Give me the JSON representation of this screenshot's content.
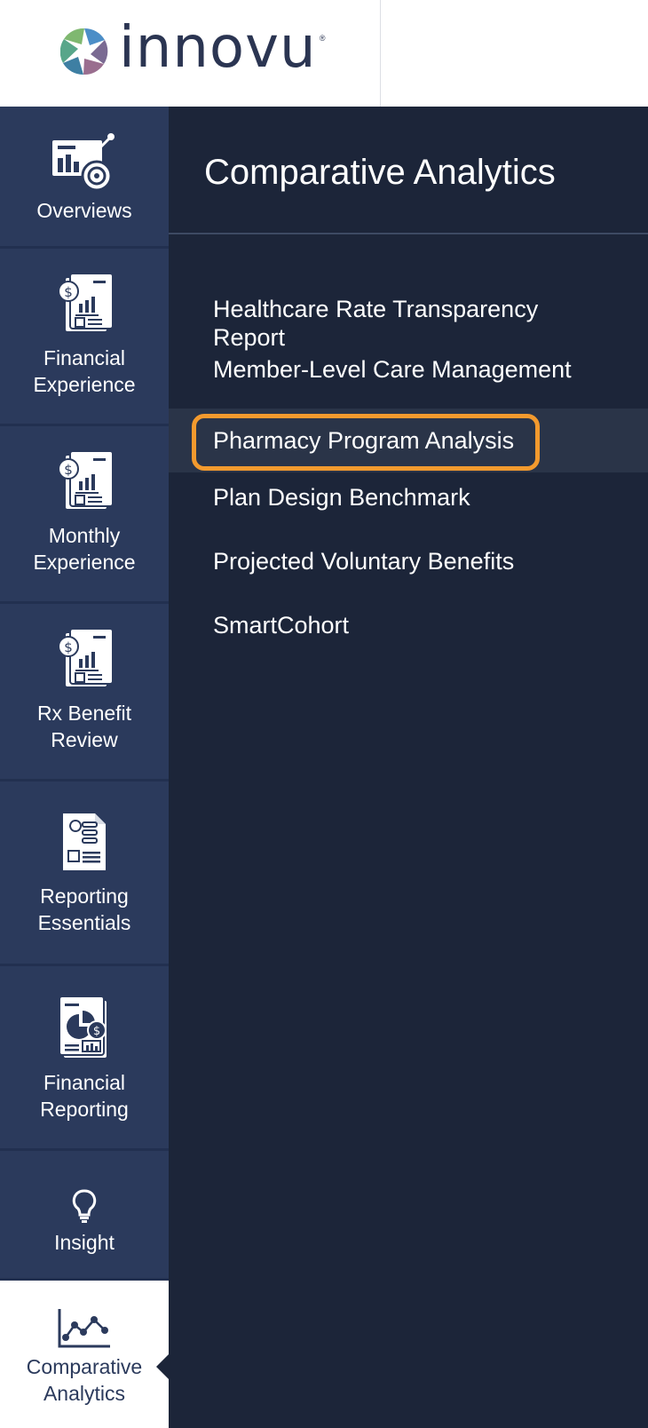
{
  "header": {
    "logo_text": "innovu",
    "logo_mark": "®"
  },
  "sidebar": {
    "items": [
      {
        "label": "Overviews",
        "icon": "analytics-dashboard-icon"
      },
      {
        "label": "Financial\nExperience",
        "icon": "financial-report-icon"
      },
      {
        "label": "Monthly\nExperience",
        "icon": "financial-report-icon"
      },
      {
        "label": "Rx Benefit\nReview",
        "icon": "financial-report-icon"
      },
      {
        "label": "Reporting\nEssentials",
        "icon": "report-document-icon"
      },
      {
        "label": "Financial\nReporting",
        "icon": "pie-chart-report-icon"
      },
      {
        "label": "Insight",
        "icon": "lightbulb-icon"
      },
      {
        "label": "Comparative\nAnalytics",
        "icon": "line-chart-icon"
      }
    ],
    "active_index": 7
  },
  "panel": {
    "title": "Comparative Analytics",
    "items": [
      "Healthcare Rate Transparency\nReport",
      "Member-Level Care Management",
      "Pharmacy Program Analysis",
      "Plan Design Benchmark",
      "Projected Voluntary Benefits",
      "SmartCohort"
    ],
    "highlighted_index": 2
  },
  "colors": {
    "sidebar_bg": "#2b3a5c",
    "panel_bg": "#1c2539",
    "highlight": "#f39a2e"
  }
}
